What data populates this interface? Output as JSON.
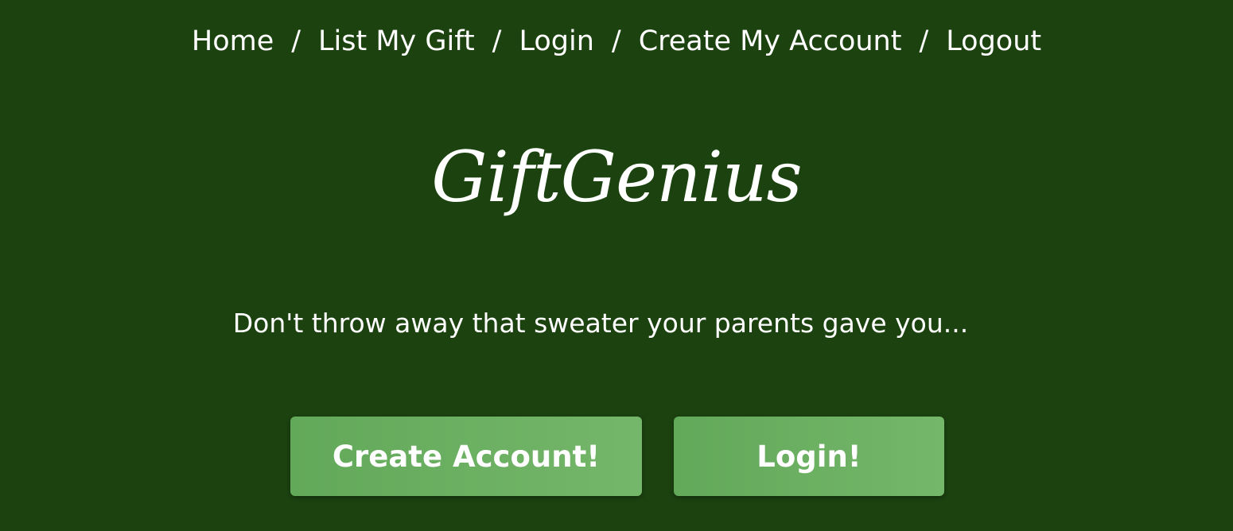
{
  "nav": {
    "items": [
      {
        "label": "Home"
      },
      {
        "label": "List My Gift"
      },
      {
        "label": "Login"
      },
      {
        "label": "Create My Account"
      },
      {
        "label": "Logout"
      }
    ],
    "separator": "/"
  },
  "brand": {
    "logo_text": "GiftGenius"
  },
  "hero": {
    "tagline": "Don't throw away that sweater your parents gave you..."
  },
  "actions": {
    "create_account_label": "Create Account!",
    "login_label": "Login!"
  },
  "colors": {
    "background": "#1c4210",
    "button": "#6aaf60",
    "text": "#ffffff"
  }
}
